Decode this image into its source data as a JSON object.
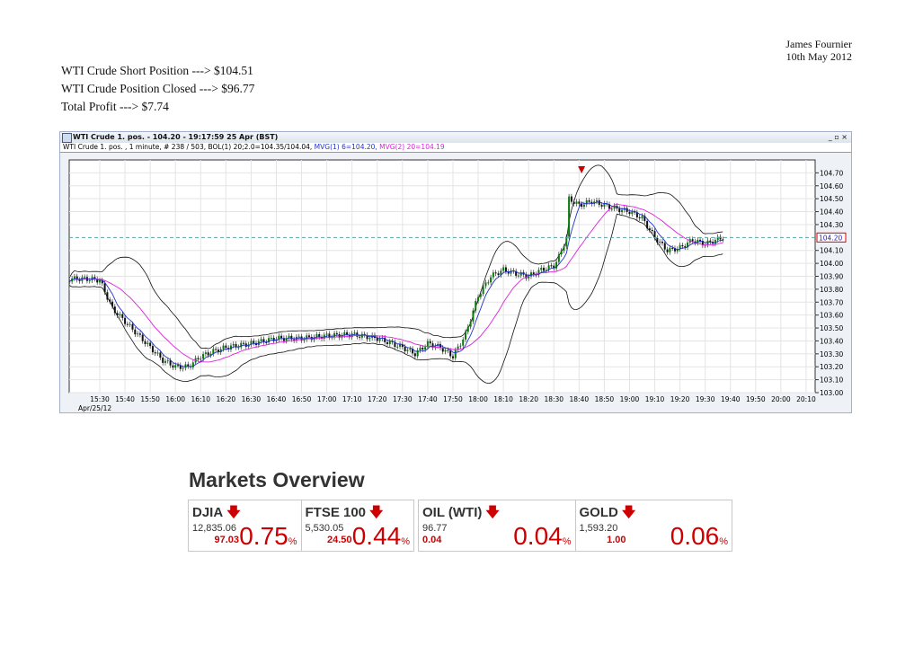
{
  "header": {
    "author": "James Fournier",
    "date": "10th May 2012"
  },
  "notes": [
    "WTI Crude Short Position ---> $104.51",
    "WTI Crude Position Closed ---> $96.77",
    "Total Profit ---> $7.74"
  ],
  "window": {
    "title": "WTI Crude 1. pos. - 104.20 - 19:17:59  25 Apr (BST)",
    "controls": "_ ▫ ×",
    "info_main": "WTI Crude 1. pos. , 1 minute, # 238 / 503, BOL(1) 20;2.0=104.35/104.04, ",
    "info_mvg1": "MVG(1) 6=104.20, ",
    "info_mvg2": "MVG(2) 20=104.19"
  },
  "colors": {
    "mvg1": "#2233cc",
    "mvg2": "#dd22dd",
    "down": "#cc0000",
    "last": "#5aa5a5"
  },
  "chart_data": {
    "type": "line",
    "title": "WTI Crude 1 minute",
    "date_label": "Apr/25/12",
    "xticks": [
      "15:30",
      "15:40",
      "15:50",
      "16:00",
      "16:10",
      "16:20",
      "16:30",
      "16:40",
      "16:50",
      "17:00",
      "17:10",
      "17:20",
      "17:30",
      "17:40",
      "17:50",
      "18:00",
      "18:10",
      "18:20",
      "18:30",
      "18:40",
      "18:50",
      "19:00",
      "19:10",
      "19:20",
      "19:30",
      "19:40",
      "19:50",
      "20:00",
      "20:10"
    ],
    "yticks": [
      "104.70",
      "104.60",
      "104.50",
      "104.40",
      "104.30",
      "104.10",
      "104.00",
      "103.90",
      "103.80",
      "103.70",
      "103.60",
      "103.50",
      "103.40",
      "103.30",
      "103.20",
      "103.10",
      "103.00"
    ],
    "ylim": [
      103.0,
      104.8
    ],
    "last_price": "104.20",
    "sell_marker_time": "18:41",
    "x_minutes_from_1530": [
      -12,
      -5,
      0,
      5,
      10,
      15,
      20,
      25,
      30,
      35,
      40,
      45,
      50,
      60,
      70,
      80,
      90,
      100,
      110,
      120,
      125,
      130,
      135,
      140,
      145,
      150,
      155,
      160,
      165,
      170,
      175,
      180,
      185,
      182,
      186,
      190,
      195,
      200,
      205,
      210,
      215,
      220,
      225,
      230,
      235,
      240,
      247
    ],
    "prices": [
      103.88,
      103.88,
      103.87,
      103.65,
      103.55,
      103.45,
      103.35,
      103.25,
      103.2,
      103.2,
      103.28,
      103.32,
      103.35,
      103.38,
      103.42,
      103.42,
      103.44,
      103.45,
      103.42,
      103.35,
      103.3,
      103.38,
      103.35,
      103.28,
      103.45,
      103.75,
      103.9,
      103.95,
      103.92,
      103.9,
      103.95,
      103.98,
      104.2,
      104.05,
      104.5,
      104.45,
      104.48,
      104.45,
      104.42,
      104.4,
      104.35,
      104.2,
      104.1,
      104.12,
      104.18,
      104.15,
      104.2
    ]
  },
  "markets": {
    "title": "Markets Overview",
    "items": [
      {
        "name": "DJIA",
        "value": "12,835.06",
        "change": "97.03",
        "pct": "0.75",
        "unit": "%"
      },
      {
        "name": "FTSE 100",
        "value": "5,530.05",
        "change": "24.50",
        "pct": "0.44",
        "unit": "%"
      },
      {
        "name": "OIL (WTI)",
        "value": "96.77",
        "change": "0.04",
        "pct": "0.04",
        "unit": "%"
      },
      {
        "name": "GOLD",
        "value": "1,593.20",
        "change": "1.00",
        "pct": "0.06",
        "unit": "%"
      }
    ]
  }
}
